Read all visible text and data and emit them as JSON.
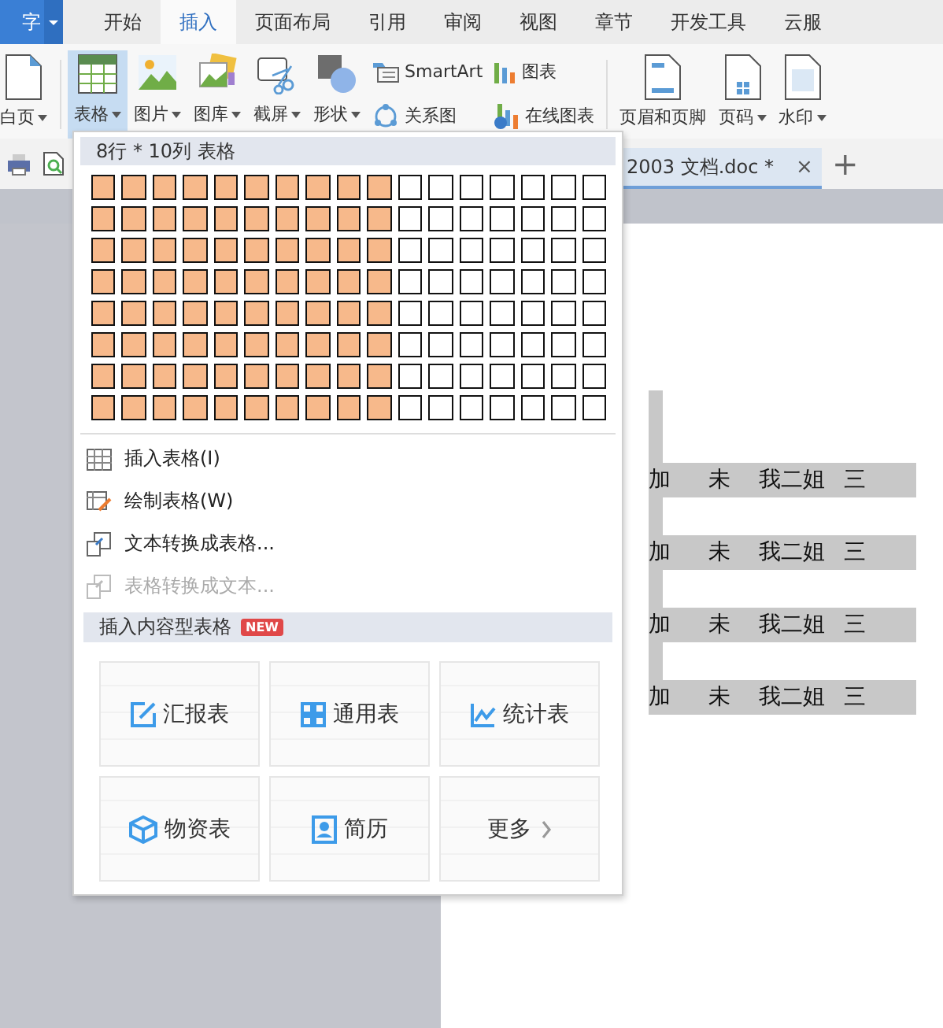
{
  "app_button": {
    "label": "字"
  },
  "menu_tabs": [
    {
      "label": "开始",
      "selected": false
    },
    {
      "label": "插入",
      "selected": true
    },
    {
      "label": "页面布局",
      "selected": false
    },
    {
      "label": "引用",
      "selected": false
    },
    {
      "label": "审阅",
      "selected": false
    },
    {
      "label": "视图",
      "selected": false
    },
    {
      "label": "章节",
      "selected": false
    },
    {
      "label": "开发工具",
      "selected": false
    },
    {
      "label": "云服",
      "selected": false
    }
  ],
  "ribbon": [
    {
      "label": "白页",
      "kind": "page",
      "dropdown": true,
      "selected": false
    },
    {
      "label": "表格",
      "kind": "table",
      "dropdown": true,
      "selected": true
    },
    {
      "label": "图片",
      "kind": "picture",
      "dropdown": true,
      "selected": false
    },
    {
      "label": "图库",
      "kind": "gallery",
      "dropdown": true,
      "selected": false
    },
    {
      "label": "截屏",
      "kind": "screenshot",
      "dropdown": true,
      "selected": false
    },
    {
      "label": "形状",
      "kind": "shape",
      "dropdown": true,
      "selected": false
    },
    {
      "kind": "pair",
      "items": [
        {
          "label": "SmartArt"
        },
        {
          "label": "关系图"
        }
      ]
    },
    {
      "kind": "pair2",
      "items": [
        {
          "label": "图表"
        },
        {
          "label": "在线图表"
        }
      ]
    },
    {
      "label": "页眉和页脚",
      "kind": "header",
      "dropdown": false,
      "selected": false
    },
    {
      "label": "页码",
      "kind": "pagenum",
      "dropdown": true,
      "selected": false
    },
    {
      "label": "水印",
      "kind": "watermark",
      "dropdown": true,
      "selected": false
    }
  ],
  "document_tab": {
    "title": "2003 文档.doc *",
    "close": "×",
    "add": "+"
  },
  "table_menu": {
    "header": "8行 * 10列 表格",
    "grid": [
      [
        {
          "selected": true
        },
        {
          "selected": true
        },
        {
          "selected": true
        },
        {
          "selected": true
        },
        {
          "selected": true
        },
        {
          "selected": true
        },
        {
          "selected": true
        },
        {
          "selected": true
        },
        {
          "selected": true
        },
        {
          "selected": true
        },
        {
          "selected": false
        },
        {
          "selected": false
        },
        {
          "selected": false
        },
        {
          "selected": false
        },
        {
          "selected": false
        },
        {
          "selected": false
        },
        {
          "selected": false
        }
      ],
      [
        {
          "selected": true
        },
        {
          "selected": true
        },
        {
          "selected": true
        },
        {
          "selected": true
        },
        {
          "selected": true
        },
        {
          "selected": true
        },
        {
          "selected": true
        },
        {
          "selected": true
        },
        {
          "selected": true
        },
        {
          "selected": true
        },
        {
          "selected": false
        },
        {
          "selected": false
        },
        {
          "selected": false
        },
        {
          "selected": false
        },
        {
          "selected": false
        },
        {
          "selected": false
        },
        {
          "selected": false
        }
      ],
      [
        {
          "selected": true
        },
        {
          "selected": true
        },
        {
          "selected": true
        },
        {
          "selected": true
        },
        {
          "selected": true
        },
        {
          "selected": true
        },
        {
          "selected": true
        },
        {
          "selected": true
        },
        {
          "selected": true
        },
        {
          "selected": true
        },
        {
          "selected": false
        },
        {
          "selected": false
        },
        {
          "selected": false
        },
        {
          "selected": false
        },
        {
          "selected": false
        },
        {
          "selected": false
        },
        {
          "selected": false
        }
      ],
      [
        {
          "selected": true
        },
        {
          "selected": true
        },
        {
          "selected": true
        },
        {
          "selected": true
        },
        {
          "selected": true
        },
        {
          "selected": true
        },
        {
          "selected": true
        },
        {
          "selected": true
        },
        {
          "selected": true
        },
        {
          "selected": true
        },
        {
          "selected": false
        },
        {
          "selected": false
        },
        {
          "selected": false
        },
        {
          "selected": false
        },
        {
          "selected": false
        },
        {
          "selected": false
        },
        {
          "selected": false
        }
      ],
      [
        {
          "selected": true
        },
        {
          "selected": true
        },
        {
          "selected": true
        },
        {
          "selected": true
        },
        {
          "selected": true
        },
        {
          "selected": true
        },
        {
          "selected": true
        },
        {
          "selected": true
        },
        {
          "selected": true
        },
        {
          "selected": true
        },
        {
          "selected": false
        },
        {
          "selected": false
        },
        {
          "selected": false
        },
        {
          "selected": false
        },
        {
          "selected": false
        },
        {
          "selected": false
        },
        {
          "selected": false
        }
      ],
      [
        {
          "selected": true
        },
        {
          "selected": true
        },
        {
          "selected": true
        },
        {
          "selected": true
        },
        {
          "selected": true
        },
        {
          "selected": true
        },
        {
          "selected": true
        },
        {
          "selected": true
        },
        {
          "selected": true
        },
        {
          "selected": true
        },
        {
          "selected": false
        },
        {
          "selected": false
        },
        {
          "selected": false
        },
        {
          "selected": false
        },
        {
          "selected": false
        },
        {
          "selected": false
        },
        {
          "selected": false
        }
      ],
      [
        {
          "selected": true
        },
        {
          "selected": true
        },
        {
          "selected": true
        },
        {
          "selected": true
        },
        {
          "selected": true
        },
        {
          "selected": true
        },
        {
          "selected": true
        },
        {
          "selected": true
        },
        {
          "selected": true
        },
        {
          "selected": true
        },
        {
          "selected": false
        },
        {
          "selected": false
        },
        {
          "selected": false
        },
        {
          "selected": false
        },
        {
          "selected": false
        },
        {
          "selected": false
        },
        {
          "selected": false
        }
      ],
      [
        {
          "selected": true
        },
        {
          "selected": true
        },
        {
          "selected": true
        },
        {
          "selected": true
        },
        {
          "selected": true
        },
        {
          "selected": true
        },
        {
          "selected": true
        },
        {
          "selected": true
        },
        {
          "selected": true
        },
        {
          "selected": true
        },
        {
          "selected": false
        },
        {
          "selected": false
        },
        {
          "selected": false
        },
        {
          "selected": false
        },
        {
          "selected": false
        },
        {
          "selected": false
        },
        {
          "selected": false
        }
      ]
    ],
    "items": [
      {
        "label": "插入表格(I)",
        "disabled": false
      },
      {
        "label": "绘制表格(W)",
        "disabled": false
      },
      {
        "label": "文本转换成表格...",
        "disabled": false
      },
      {
        "label": "表格转换成文本...",
        "disabled": true
      }
    ],
    "section": {
      "title": "插入内容型表格",
      "badge": "NEW"
    },
    "cards": [
      {
        "label": "汇报表"
      },
      {
        "label": "通用表"
      },
      {
        "label": "统计表"
      },
      {
        "label": "物资表"
      },
      {
        "label": "简历"
      },
      {
        "label": "更多"
      }
    ]
  },
  "document": {
    "rows": [
      [
        "加",
        "未",
        "我二姐",
        "三"
      ],
      [
        "加",
        "未",
        "我二姐",
        "三"
      ],
      [
        "加",
        "未",
        "我二姐",
        "三"
      ],
      [
        "加",
        "未",
        "我二姐",
        "三"
      ]
    ]
  }
}
